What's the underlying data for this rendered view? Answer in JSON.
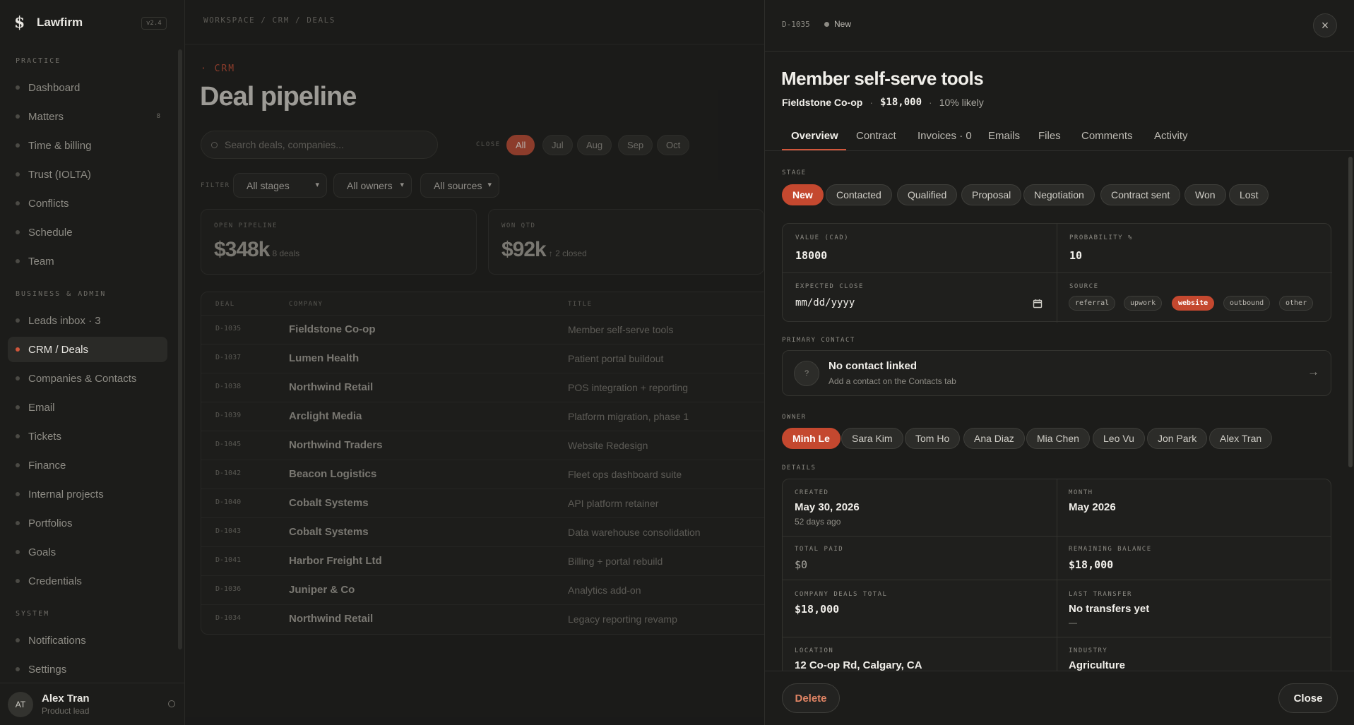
{
  "brand": {
    "name": "Lawfirm",
    "version": "v2.4"
  },
  "sidebar": {
    "sections": [
      {
        "title": "PRACTICE"
      },
      {
        "title": "BUSINESS & ADMIN"
      },
      {
        "title": "SYSTEM"
      }
    ],
    "items": [
      {
        "label": "Dashboard"
      },
      {
        "label": "Matters",
        "badge": "8"
      },
      {
        "label": "Time & billing"
      },
      {
        "label": "Trust (IOLTA)"
      },
      {
        "label": "Conflicts"
      },
      {
        "label": "Schedule"
      },
      {
        "label": "Team"
      },
      {
        "label": "Leads inbox · 3"
      },
      {
        "label": "CRM / Deals",
        "active": true
      },
      {
        "label": "Companies & Contacts"
      },
      {
        "label": "Email"
      },
      {
        "label": "Tickets"
      },
      {
        "label": "Finance"
      },
      {
        "label": "Internal projects"
      },
      {
        "label": "Portfolios"
      },
      {
        "label": "Goals"
      },
      {
        "label": "Credentials"
      },
      {
        "label": "Notifications"
      },
      {
        "label": "Settings"
      }
    ],
    "user": {
      "initials": "AT",
      "name": "Alex Tran",
      "role": "Product lead"
    }
  },
  "main": {
    "breadcrumb": "WORKSPACE / CRM / DEALS",
    "eyebrow": "· CRM",
    "title": "Deal pipeline",
    "search_placeholder": "Search deals, companies...",
    "close_label": "CLOSE",
    "close_filters": [
      "All",
      "Jul",
      "Aug",
      "Sep",
      "Oct"
    ],
    "filter_label": "FILTER",
    "selects": [
      "All stages",
      "All owners",
      "All sources"
    ],
    "kpis": [
      {
        "label": "OPEN PIPELINE",
        "value": "$348k",
        "sub": "8 deals"
      },
      {
        "label": "WON QTD",
        "value": "$92k",
        "sub": "↑ 2 closed"
      }
    ],
    "table": {
      "headers": [
        "DEAL",
        "COMPANY",
        "TITLE"
      ],
      "rows": [
        {
          "id": "D-1035",
          "company": "Fieldstone Co-op",
          "title": "Member self-serve tools"
        },
        {
          "id": "D-1037",
          "company": "Lumen Health",
          "title": "Patient portal buildout"
        },
        {
          "id": "D-1038",
          "company": "Northwind Retail",
          "title": "POS integration + reporting"
        },
        {
          "id": "D-1039",
          "company": "Arclight Media",
          "title": "Platform migration, phase 1"
        },
        {
          "id": "D-1045",
          "company": "Northwind Traders",
          "title": "Website Redesign"
        },
        {
          "id": "D-1042",
          "company": "Beacon Logistics",
          "title": "Fleet ops dashboard suite"
        },
        {
          "id": "D-1040",
          "company": "Cobalt Systems",
          "title": "API platform retainer"
        },
        {
          "id": "D-1043",
          "company": "Cobalt Systems",
          "title": "Data warehouse consolidation"
        },
        {
          "id": "D-1041",
          "company": "Harbor Freight Ltd",
          "title": "Billing + portal rebuild"
        },
        {
          "id": "D-1036",
          "company": "Juniper & Co",
          "title": "Analytics add-on"
        },
        {
          "id": "D-1034",
          "company": "Northwind Retail",
          "title": "Legacy reporting revamp"
        }
      ]
    }
  },
  "drawer": {
    "deal_id": "D-1035",
    "status": "New",
    "title": "Member self-serve tools",
    "company": "Fieldstone Co-op",
    "amount": "$18,000",
    "likely": "10% likely",
    "tabs": [
      "Overview",
      "Contract",
      "Invoices · 0",
      "Emails",
      "Files",
      "Comments",
      "Activity"
    ],
    "stage_label": "STAGE",
    "stages": [
      "New",
      "Contacted",
      "Qualified",
      "Proposal",
      "Negotiation",
      "Contract sent",
      "Won",
      "Lost"
    ],
    "fields": {
      "value_label": "VALUE (CAD)",
      "value": "18000",
      "probability_label": "PROBABILITY %",
      "probability": "10",
      "close_label": "EXPECTED CLOSE",
      "close_placeholder": "mm/dd/yyyy",
      "source_label": "SOURCE",
      "sources": [
        "referral",
        "upwork",
        "website",
        "outbound",
        "other"
      ]
    },
    "contact": {
      "label": "PRIMARY CONTACT",
      "avatar": "?",
      "title": "No contact linked",
      "subtitle": "Add a contact on the Contacts tab"
    },
    "owner_label": "OWNER",
    "owners": [
      "Minh Le",
      "Sara Kim",
      "Tom Ho",
      "Ana Diaz",
      "Mia Chen",
      "Leo Vu",
      "Jon Park",
      "Alex Tran"
    ],
    "details_label": "DETAILS",
    "details": {
      "created_label": "CREATED",
      "created": "May 30, 2026",
      "created_sub": "52 days ago",
      "month_label": "MONTH",
      "month": "May 2026",
      "paid_label": "TOTAL PAID",
      "paid": "$0",
      "balance_label": "REMAINING BALANCE",
      "balance": "$18,000",
      "company_total_label": "COMPANY DEALS TOTAL",
      "company_total": "$18,000",
      "transfer_label": "LAST TRANSFER",
      "transfer": "No transfers yet",
      "transfer_sub": "—",
      "location_label": "LOCATION",
      "location": "12 Co-op Rd, Calgary, CA",
      "industry_label": "INDUSTRY",
      "industry": "Agriculture"
    },
    "delete_label": "Delete",
    "close_label": "Close",
    "colors": {
      "accent": "#c4482f",
      "background": "#1c1c1a"
    }
  }
}
